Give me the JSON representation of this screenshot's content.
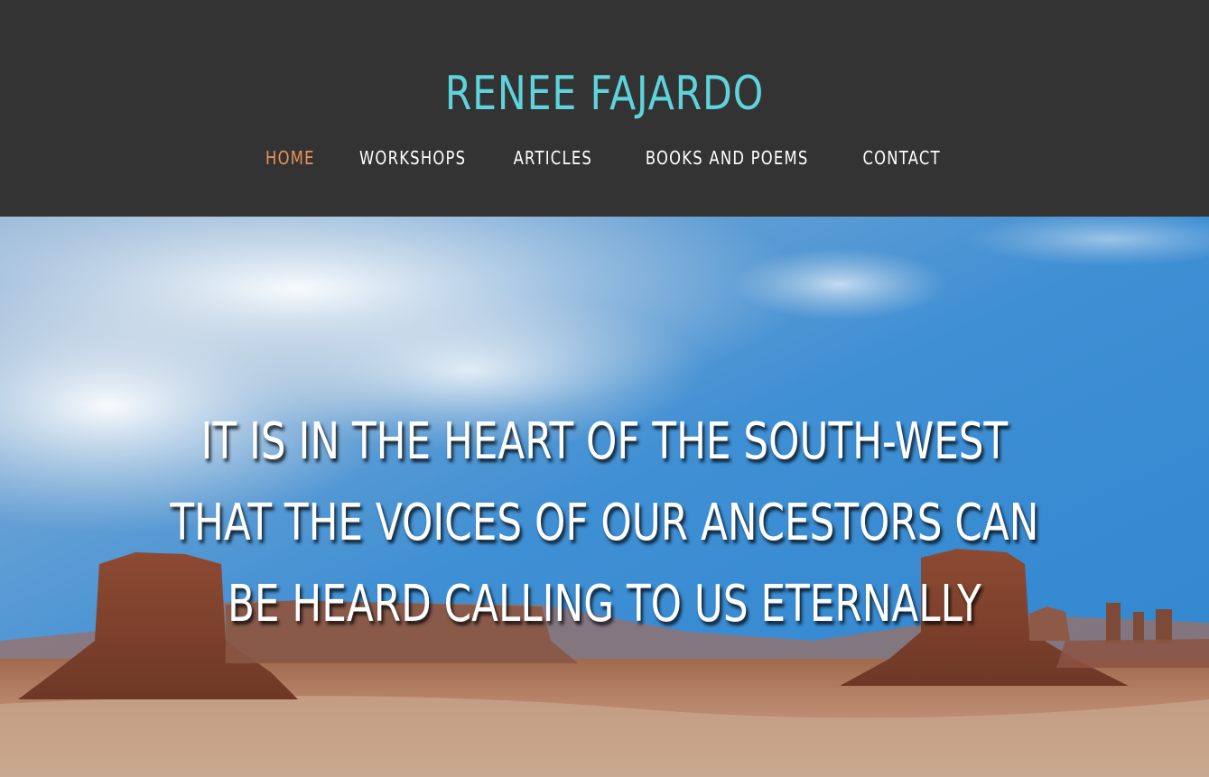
{
  "header": {
    "site_title": "RENEE FAJARDO",
    "nav": [
      {
        "label": "HOME",
        "active": true
      },
      {
        "label": "WORKSHOPS",
        "active": false
      },
      {
        "label": "ARTICLES",
        "active": false
      },
      {
        "label": "BOOKS AND POEMS",
        "active": false
      },
      {
        "label": "CONTACT",
        "active": false
      }
    ]
  },
  "hero": {
    "quote": "IT IS IN THE HEART OF THE SOUTH-WEST THAT THE VOICES OF OUR ANCESTORS CAN BE HEARD CALLING TO US ETERNALLY"
  },
  "colors": {
    "header_bg": "#333333",
    "title": "#5fd3dc",
    "nav_text": "#ffffff",
    "nav_active": "#e8925a"
  }
}
